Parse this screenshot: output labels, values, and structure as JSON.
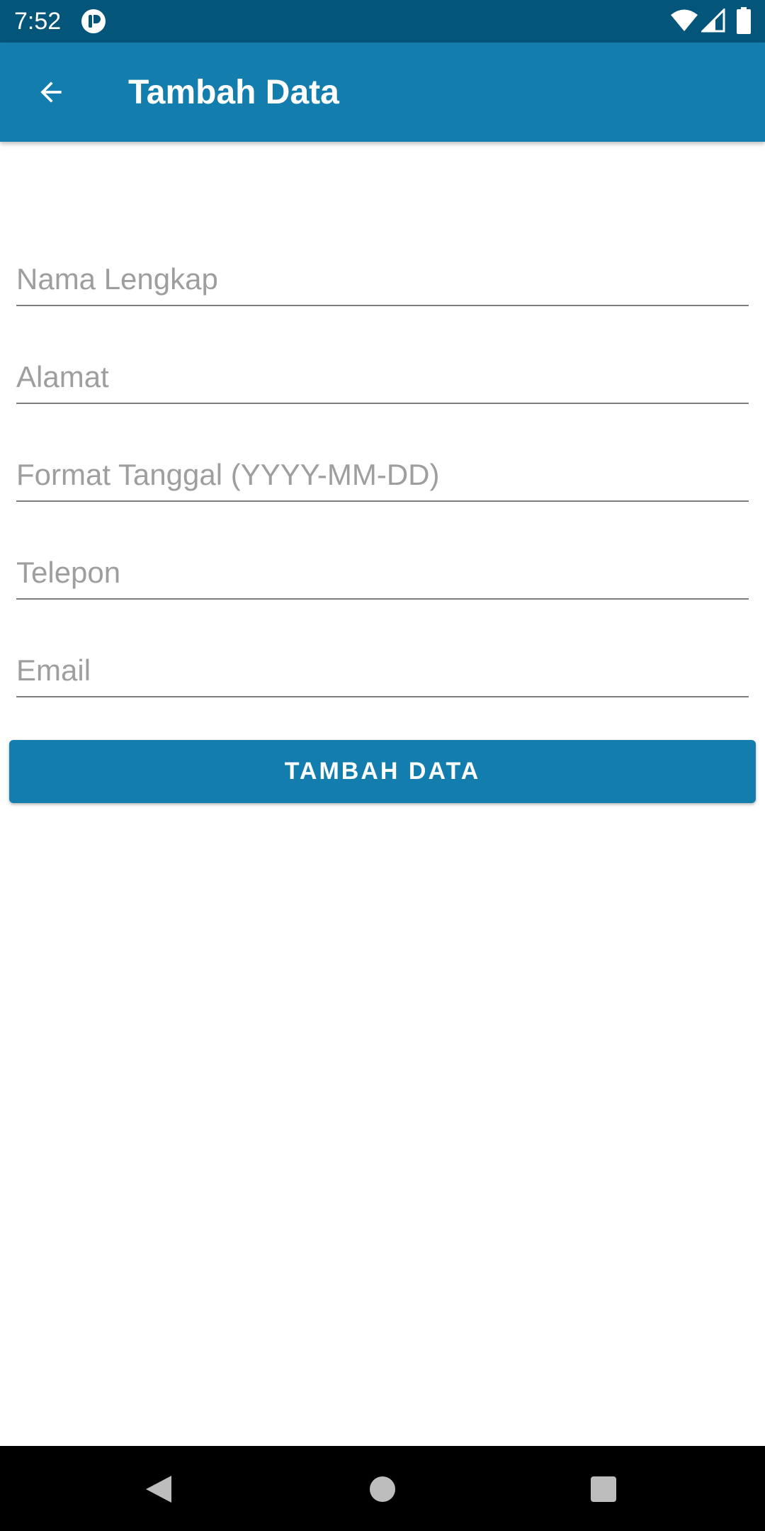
{
  "status_bar": {
    "time": "7:52",
    "icons": [
      "app-notification-icon",
      "wifi-icon",
      "cell-signal-icon",
      "battery-icon"
    ]
  },
  "app_bar": {
    "back_icon": "arrow-left-icon",
    "title": "Tambah Data",
    "color": "#137ead"
  },
  "form": {
    "fields": [
      {
        "placeholder": "Nama Lengkap",
        "value": ""
      },
      {
        "placeholder": "Alamat",
        "value": ""
      },
      {
        "placeholder": "Format Tanggal (YYYY-MM-DD)",
        "value": ""
      },
      {
        "placeholder": "Telepon",
        "value": ""
      },
      {
        "placeholder": "Email",
        "value": ""
      }
    ],
    "submit_label": "TAMBAH DATA"
  },
  "nav_bar": {
    "icons": [
      "nav-back-icon",
      "nav-home-icon",
      "nav-recents-icon"
    ]
  },
  "colors": {
    "status_bar": "#03557a",
    "accent": "#137ead",
    "underline": "#7d7d7d",
    "placeholder": "#9e9e9e"
  }
}
